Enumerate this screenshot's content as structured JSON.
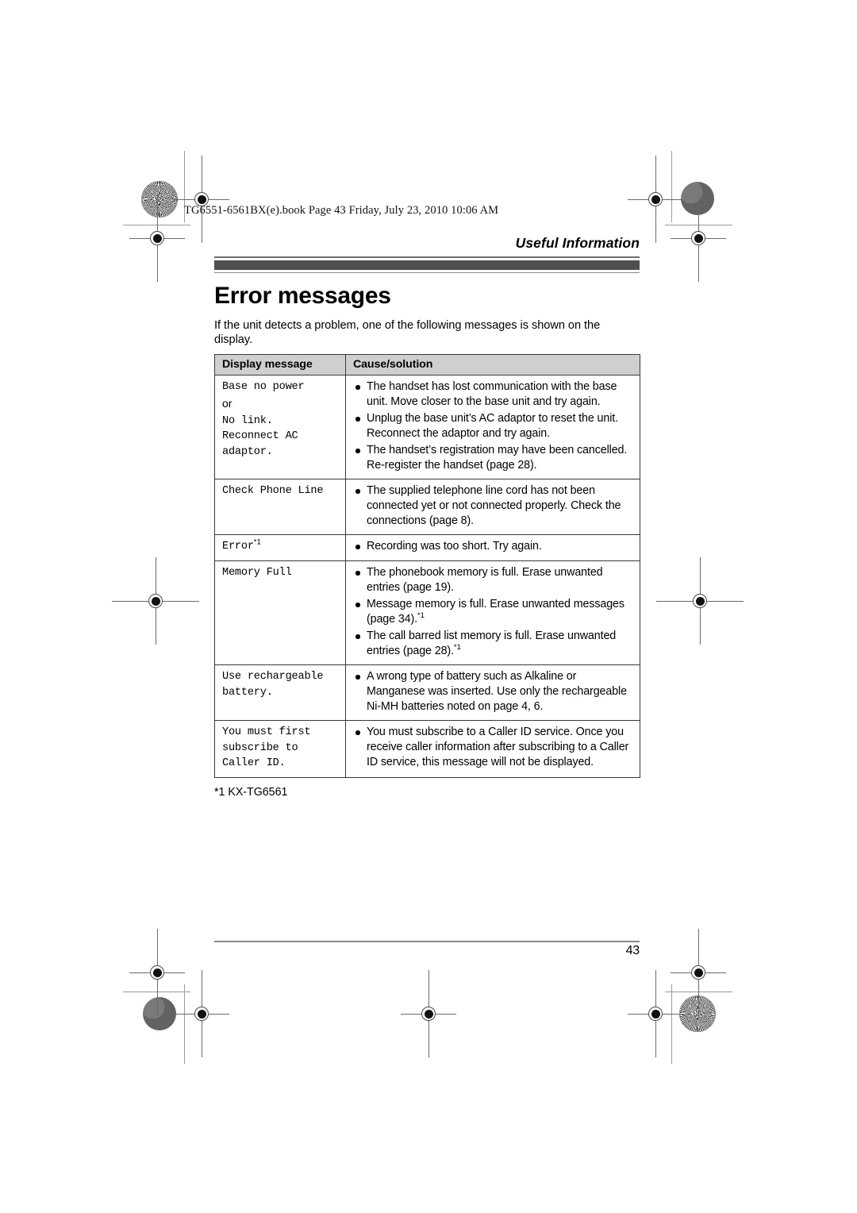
{
  "print_header": "TG6551-6561BX(e).book  Page 43  Friday, July 23, 2010  10:06 AM",
  "running_head": "Useful Information",
  "section_title": "Error messages",
  "intro": "If the unit detects a problem, one of the following messages is shown on the display.",
  "table": {
    "headers": {
      "col1": "Display message",
      "col2": "Cause/solution"
    },
    "rows": [
      {
        "message_lines": [
          {
            "text": "Base no power",
            "style": "mono"
          },
          {
            "text": "or",
            "style": "plain"
          },
          {
            "text": "No link.",
            "style": "mono"
          },
          {
            "text": "Reconnect AC",
            "style": "mono"
          },
          {
            "text": "adaptor.",
            "style": "mono"
          }
        ],
        "message_footnote": "",
        "causes": [
          "The handset has lost communication with the base unit. Move closer to the base unit and try again.",
          "Unplug the base unit’s AC adaptor to reset the unit. Reconnect the adaptor and try again.",
          "The handset’s registration may have been cancelled. Re-register the handset (page 28)."
        ],
        "cause_footnotes": [
          "",
          "",
          ""
        ]
      },
      {
        "message_lines": [
          {
            "text": "Check Phone Line",
            "style": "mono"
          }
        ],
        "message_footnote": "",
        "causes": [
          "The supplied telephone line cord has not been connected yet or not connected properly. Check the connections (page 8)."
        ],
        "cause_footnotes": [
          ""
        ]
      },
      {
        "message_lines": [
          {
            "text": "Error",
            "style": "mono"
          }
        ],
        "message_footnote": "*1",
        "causes": [
          "Recording was too short. Try again."
        ],
        "cause_footnotes": [
          ""
        ]
      },
      {
        "message_lines": [
          {
            "text": "Memory Full",
            "style": "mono"
          }
        ],
        "message_footnote": "",
        "causes": [
          "The phonebook memory is full. Erase unwanted entries (page 19).",
          "Message memory is full. Erase unwanted messages (page 34).",
          "The call barred list memory is full. Erase unwanted entries (page 28)."
        ],
        "cause_footnotes": [
          "",
          "*1",
          "*1"
        ]
      },
      {
        "message_lines": [
          {
            "text": "Use rechargeable",
            "style": "mono"
          },
          {
            "text": "battery.",
            "style": "mono"
          }
        ],
        "message_footnote": "",
        "causes": [
          "A wrong type of battery such as Alkaline or Manganese was inserted. Use only the rechargeable Ni-MH batteries noted on page 4, 6."
        ],
        "cause_footnotes": [
          ""
        ]
      },
      {
        "message_lines": [
          {
            "text": "You must first",
            "style": "mono"
          },
          {
            "text": "subscribe to",
            "style": "mono"
          },
          {
            "text": "Caller ID.",
            "style": "mono"
          }
        ],
        "message_footnote": "",
        "causes": [
          "You must subscribe to a Caller ID service. Once you receive caller information after subscribing to a Caller ID service, this message will not be displayed."
        ],
        "cause_footnotes": [
          ""
        ]
      }
    ]
  },
  "footnote": "*1 KX-TG6561",
  "page_number": "43",
  "colors": {
    "header_bar": "#4f4f4f",
    "table_header_bg": "#cfcfcf",
    "rule": "#6d6d6d",
    "text": "#000000"
  }
}
